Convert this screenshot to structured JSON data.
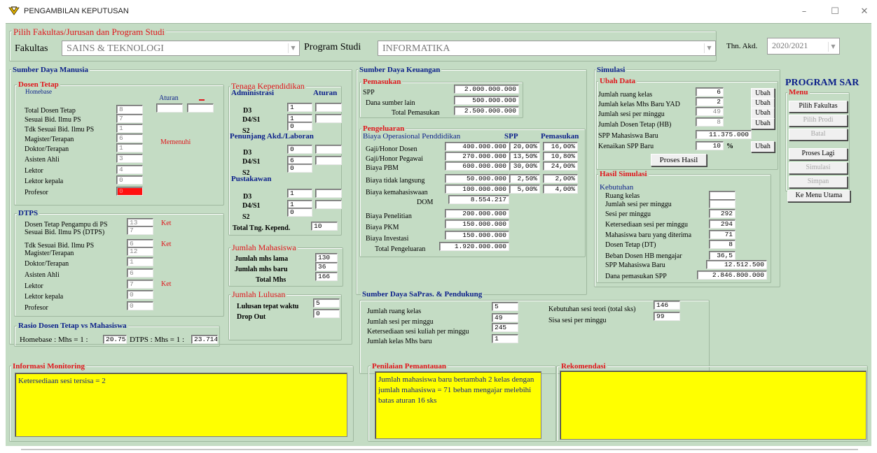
{
  "window": {
    "title": "PENGAMBILAN KEPUTUSAN",
    "minimize": "–",
    "maximize": "☐",
    "close": "✕",
    "icon": "app-logo-icon"
  },
  "program": {
    "group_title": "Pilih Fakultas/Jurusan  dan  Program Studi",
    "fakultas_label": "Fakultas",
    "fakultas_value": "SAINS & TEKNOLOGI",
    "prodi_label": "Program Studi",
    "prodi_value": "INFORMATIKA",
    "thn_label": "Thn. Akd.",
    "thn_value": "2020/2021"
  },
  "heading": "PROGRAM SAR",
  "sdm": {
    "title": "Sumber Daya Manusia",
    "dosen": {
      "title": "Dosen Tetap",
      "homebase": "Homebase",
      "aturan": "Aturan",
      "memenuhi": "Memenuhi",
      "rows": [
        {
          "label": "Total Dosen Tetap",
          "value": "8"
        },
        {
          "label": "Sesuai Bid. Ilmu PS",
          "value": "7"
        },
        {
          "label": "Tdk Sesuai Bid. Ilmu PS",
          "value": "1"
        },
        {
          "label": "Magister/Terapan",
          "value": "6"
        },
        {
          "label": "Doktor/Terapan",
          "value": "1"
        },
        {
          "label": "Asisten Ahli",
          "value": "3"
        },
        {
          "label": "Lektor",
          "value": "4"
        },
        {
          "label": "Lektor kepala",
          "value": "0"
        },
        {
          "label": "Profesor",
          "value": "0"
        }
      ]
    },
    "dtps": {
      "title": "DTPS",
      "ket": "Ket",
      "rows": [
        {
          "label": "Dosen Tetap Pengampu di  PS",
          "value": "13"
        },
        {
          "label": "Sesuai Bid. Ilmu PS (DTPS)",
          "value": "7"
        },
        {
          "label": "Tdk Sesuai Bid. Ilmu PS",
          "value": "6"
        },
        {
          "label": "Magister/Terapan",
          "value": "12"
        },
        {
          "label": "Doktor/Terapan",
          "value": "1"
        },
        {
          "label": "Asisten Ahli",
          "value": "6"
        },
        {
          "label": "Lektor",
          "value": "7"
        },
        {
          "label": "Lektor kepala",
          "value": "0"
        },
        {
          "label": "Profesor",
          "value": "0"
        }
      ]
    },
    "rasio": {
      "title": "Rasio Dosen Tetap vs Mahasiswa",
      "homebase_label": "Homebase : Mhs = 1 :",
      "homebase_value": "20.75",
      "dtps_label": "DTPS : Mhs = 1 :",
      "dtps_value": "23.714"
    }
  },
  "tendik": {
    "title": "Tenaga Kependidikan",
    "adm": "Administrasi",
    "aturan": "Aturan",
    "d3": "D3",
    "d4s1": "D4/S1",
    "s2": "S2",
    "adm_vals": [
      "1",
      "1",
      "0"
    ],
    "penunjang": "Penunjang Akd./Laboran",
    "pen_vals": [
      "0",
      "6",
      "0"
    ],
    "pustakawan": "Pustakawan",
    "pus_vals": [
      "1",
      "1",
      "0"
    ],
    "total_label": "Total  Tng. Kepend.",
    "total_value": "10"
  },
  "mhs": {
    "title": "Jumlah Mahasiswa",
    "lama_label": "Jumlah mhs lama",
    "lama_value": "130",
    "baru_label": "Jumlah mhs baru",
    "baru_value": "36",
    "total_label": "Total Mhs",
    "total_value": "166"
  },
  "lulusan": {
    "title": "Jumlah Lulusan",
    "tepat_label": "Lulusan tepat waktu",
    "tepat_value": "5",
    "do_label": "Drop Out",
    "do_value": "0"
  },
  "keuangan": {
    "title": "Sumber Daya Keuangan",
    "pemasukan": {
      "title": "Pemasukan",
      "spp_label": "SPP",
      "spp_value": "2.000.000.000",
      "lain_label": "Dana sumber lain",
      "lain_value": "500.000.000",
      "total_label": "Total Pemasukan",
      "total_value": "2.500.000.000"
    },
    "pengeluaran": {
      "title": "Pengeluaran",
      "bop": "Biaya Operasional Penddidikan",
      "spp_h": "SPP",
      "pem_h": "Pemasukan",
      "rows": [
        {
          "label": "Gaji/Honor Dosen",
          "value": "400.000.000",
          "spp": "20,00%",
          "pem": "16,00%"
        },
        {
          "label": "Gaji/Honor Pegawai",
          "value": "270.000.000",
          "spp": "13,50%",
          "pem": "10,80%"
        },
        {
          "label": "Biaya PBM",
          "value": "600.000.000",
          "spp": "30,00%",
          "pem": "24,00%"
        },
        {
          "label": "Biaya tidak langsung",
          "value": "50.000.000",
          "spp": "2,50%",
          "pem": "2,00%"
        },
        {
          "label": "Biaya kemahasiswaan",
          "value": "100.000.000",
          "spp": "5,00%",
          "pem": "4,00%"
        }
      ],
      "dom_label": "DOM",
      "dom_value": "8.554.217",
      "penelitian_label": "Biaya Penelitian",
      "penelitian_value": "200.000.000",
      "pkm_label": "Biaya PKM",
      "pkm_value": "150.000.000",
      "investasi_label": "Biaya Investasi",
      "investasi_value": "150.000.000",
      "total_label": "Total Pengeluaran",
      "total_value": "1.920.000.000"
    }
  },
  "simulasi": {
    "title": "Simulasi",
    "ubah_title": "Ubah Data",
    "ubah": "Ubah",
    "rows": [
      {
        "label": "Jumlah ruang kelas",
        "value": "6"
      },
      {
        "label": "Jumlah kelas Mhs Baru  YAD",
        "value": "2"
      },
      {
        "label": "Jumlah sesi per minggu",
        "value": "49"
      },
      {
        "label": "Jumlah Dosen Tetap (HB)",
        "value": "8"
      }
    ],
    "spp_baru_label": "SPP Mahasiswa Baru",
    "spp_baru_value": "11.375.000",
    "kenaikan_label": "Kenaikan SPP Baru",
    "kenaikan_value": "10",
    "pct": "%",
    "proses_hasil": "Proses Hasil"
  },
  "hasil": {
    "title": "Hasil Simulasi",
    "kebutuhan": "Kebutuhan",
    "rows": [
      {
        "label": "Ruang kelas",
        "value": ""
      },
      {
        "label": "Jumlah sesi per minggu",
        "value": ""
      },
      {
        "label": "Sesi per minggu",
        "value": "292"
      },
      {
        "label": "Ketersediaan sesi per minggu",
        "value": "294"
      },
      {
        "label": "Mahasiswa baru yang diterima",
        "value": "71"
      },
      {
        "label": "Dosen Tetap (DT)",
        "value": "8"
      },
      {
        "label": "Beban Dosen HB mengajar",
        "value": "36,5"
      }
    ],
    "spp_label": "SPP Mahasiswa Baru",
    "spp_value": "12.512.500",
    "dana_label": "Dana pemasukan SPP",
    "dana_value": "2.846.800.000"
  },
  "menu": {
    "title": "Menu",
    "pilih_fakultas": "Pilih Fakultas",
    "pilih_prodi": "Pilih Prodi",
    "batal": "Batal",
    "proses_lagi": "Proses Lagi",
    "simulasi": "Simulasi",
    "simpan": "Simpan",
    "ke_menu": "Ke Menu Utama"
  },
  "sarpras": {
    "title": "Sumber Daya SaPras. & Pendukung",
    "ruang_label": "Jumlah ruang kelas",
    "ruang_value": "5",
    "sesi_label": "Jumlah sesi per minggu",
    "sesi_value": "49",
    "ketersediaan_label": "Ketersediaan sesi  kuliah per minggu",
    "ketersediaan_value": "245",
    "kelas_label": "Jumlah kelas  Mhs baru",
    "kelas_value": "1",
    "kebutuhan_label": "Kebutuhan sesi teori (total sks)",
    "kebutuhan_value": "146",
    "sisa_label": "Sisa sesi per minggu",
    "sisa_value": "99"
  },
  "monitoring": {
    "title": "Informasi Monitoring",
    "text": "Ketersediaan sesi tersisa = 2"
  },
  "penilaian": {
    "title": "Penilaian Pemantauan",
    "text": "Jumlah mahasiswa baru bertambah 2 kelas dengan jumlah mahasiswa = 71 beban mengajar melebihi batas aturan 16 sks"
  },
  "rekomendasi": {
    "title": "Rekomendasi",
    "text": ""
  }
}
